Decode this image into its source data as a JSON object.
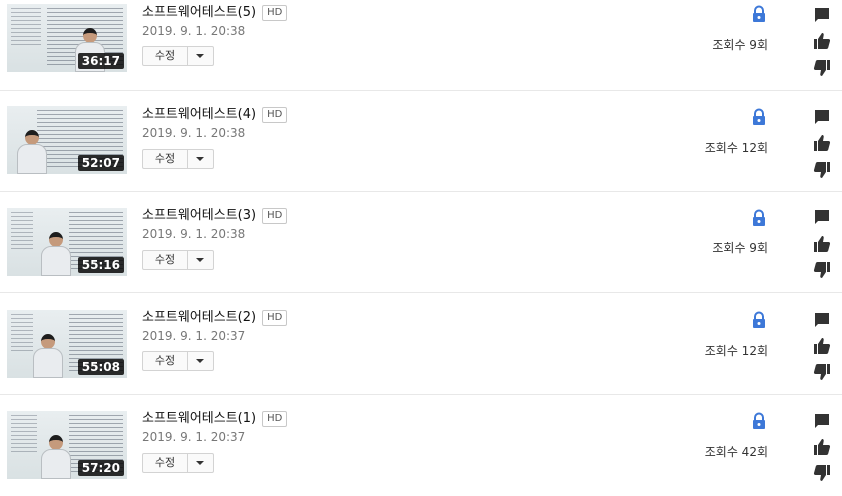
{
  "colors": {
    "lock_blue": "#3d78d8",
    "icon_dark": "#333333",
    "duration_bg": "#000000"
  },
  "icons": {
    "lock": "lock-icon",
    "comment": "comment-icon",
    "like": "thumbs-up-icon",
    "dislike": "thumbs-down-icon",
    "dropdown": "chevron-down-icon"
  },
  "videos": [
    {
      "title": "소프트웨어테스트(5)",
      "badge": "HD",
      "date": "2019. 9. 1. 20:38",
      "duration": "36:17",
      "edit_label": "수정",
      "views": "조회수 9회"
    },
    {
      "title": "소프트웨어테스트(4)",
      "badge": "HD",
      "date": "2019. 9. 1. 20:38",
      "duration": "52:07",
      "edit_label": "수정",
      "views": "조회수 12회"
    },
    {
      "title": "소프트웨어테스트(3)",
      "badge": "HD",
      "date": "2019. 9. 1. 20:38",
      "duration": "55:16",
      "edit_label": "수정",
      "views": "조회수 9회"
    },
    {
      "title": "소프트웨어테스트(2)",
      "badge": "HD",
      "date": "2019. 9. 1. 20:37",
      "duration": "55:08",
      "edit_label": "수정",
      "views": "조회수 12회"
    },
    {
      "title": "소프트웨어테스트(1)",
      "badge": "HD",
      "date": "2019. 9. 1. 20:37",
      "duration": "57:20",
      "edit_label": "수정",
      "views": "조회수 42회"
    }
  ]
}
